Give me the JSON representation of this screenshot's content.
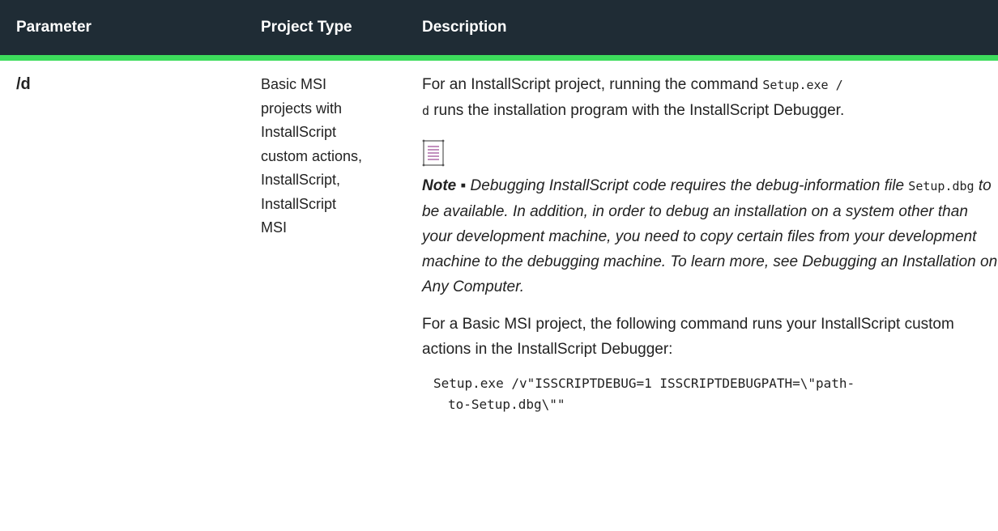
{
  "table": {
    "headers": {
      "parameter": "Parameter",
      "project_type": "Project Type",
      "description": "Description"
    },
    "row": {
      "parameter": "/d",
      "project_type_lines": [
        "Basic MSI",
        "projects with",
        "InstallScript",
        "custom actions,",
        "InstallScript,",
        "InstallScript",
        "MSI"
      ],
      "description": {
        "intro_before": "For an InstallScript project, running the command ",
        "intro_code_1": "Setup.exe /",
        "intro_code_2": "d",
        "intro_after": " runs the installation program with the InstallScript Debugger.",
        "note_icon": "note-icon",
        "note_label": "Note",
        "note_bullet": " ▪ ",
        "note_text_1": "Debugging InstallScript code requires the debug-information file ",
        "note_code": "Setup.dbg",
        "note_text_2": " to be available. In addition, in order to debug an installation on a system other than your development machine, you need to copy certain files from your development machine to the debugging machine. To learn more, see Debugging an Installation on Any Computer.",
        "basic_msi_text": "For a Basic MSI project, the following command runs your InstallScript custom actions in the InstallScript Debugger:",
        "code_line_1": "Setup.exe /v\"ISSCRIPTDEBUG=1 ISSCRIPTDEBUGPATH=\\\"path-",
        "code_line_2": "to-Setup.dbg\\\"\""
      }
    }
  },
  "colors": {
    "header_bg": "#1f2c35",
    "header_accent": "#3ddc5c",
    "text": "#222222"
  }
}
